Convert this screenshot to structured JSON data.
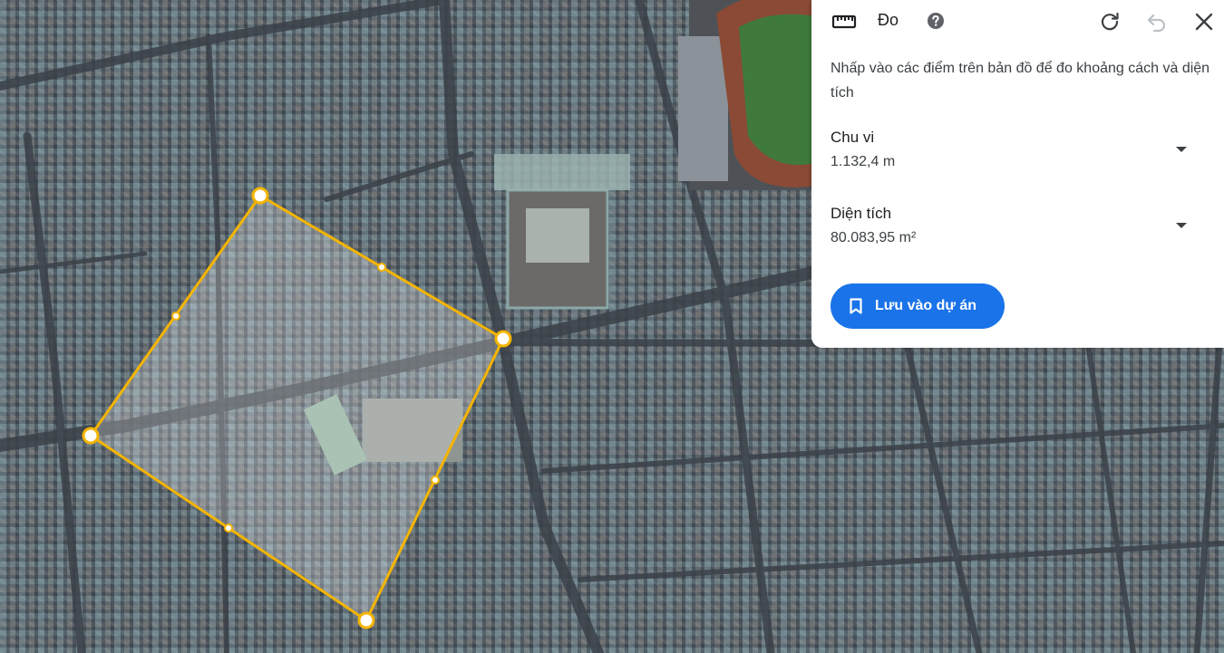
{
  "panel": {
    "title": "Đo",
    "instructions": "Nhấp vào các điểm trên bản đồ để đo khoảng cách và diện tích",
    "perimeter_label": "Chu vi",
    "perimeter_value": "1.132,4 m",
    "area_label": "Diện tích",
    "area_value": "80.083,95 m²",
    "save_label": "Lưu vào dự án"
  },
  "icons": {
    "ruler": "ruler-icon",
    "help": "help-icon",
    "reset": "reset-icon",
    "undo": "undo-icon",
    "close": "close-icon",
    "perimeter_dropdown": "chevron-down-icon",
    "area_dropdown": "chevron-down-icon",
    "save": "bookmark-icon"
  },
  "colors": {
    "measure_line": "#F4B400",
    "accent": "#1a73e8"
  }
}
